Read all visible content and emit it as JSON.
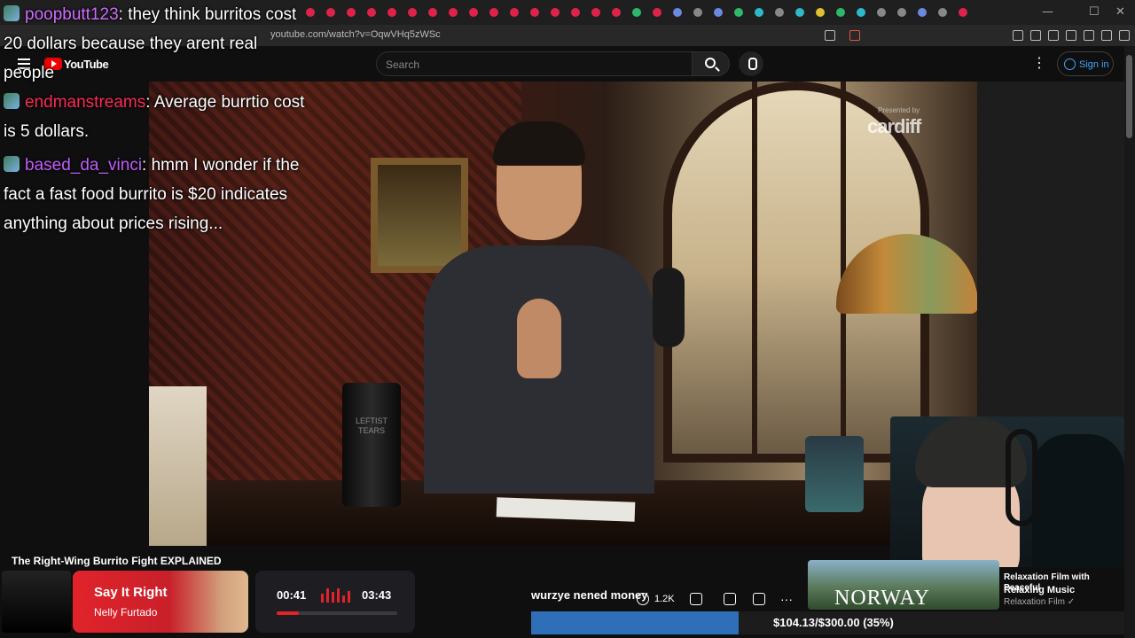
{
  "browser": {
    "url": "youtube.com/watch?v=OqwVHq5zWSc",
    "window_controls": [
      "—",
      "☐",
      "✕"
    ]
  },
  "youtube": {
    "logo_text": "YouTube",
    "search_placeholder": "Search",
    "signin_label": "Sign in",
    "more_menu": "⋮"
  },
  "chat": [
    {
      "user": "poopbutt123",
      "user_color": "#d26cff",
      "text": ": they think burritos cost 20 dollars because they arent real people"
    },
    {
      "user": "endmanstreams",
      "user_color": "#ff2a57",
      "text": ": Average burrtio cost is 5 dollars."
    },
    {
      "user": "based_da_vinci",
      "user_color": "#c45cff",
      "text": ": hmm I wonder if the fact a fast food burrito is $20 indicates anything about prices rising..."
    }
  ],
  "video": {
    "title": "The Right-Wing Burrito Fight EXPLAINED",
    "sponsor_small": "Presented by",
    "sponsor_brand": "cardiff",
    "tumbler_text": "LEFTIST TEARS",
    "likes": "1.2K"
  },
  "now_playing": {
    "title": "Say It Right",
    "artist": "Nelly Furtado",
    "time_elapsed": "00:41",
    "time_total": "03:43",
    "progress": 0.184,
    "accent": "#e1232b"
  },
  "alert": {
    "text": "wurzye nened money"
  },
  "goal": {
    "text": "$104.13/$300.00 (35%)",
    "fraction": 0.35,
    "color": "#2f6fb8"
  },
  "recommendation": {
    "thumb_label": "NORWAY",
    "title": "Relaxation Film with Peaceful",
    "subtitle": "Relaxing Music",
    "channel": "Relaxation Film ✓"
  }
}
